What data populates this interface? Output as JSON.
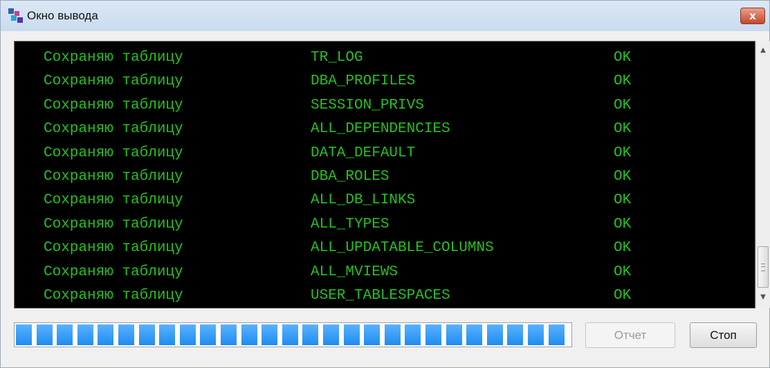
{
  "window": {
    "title": "Окно вывода",
    "close_label": "x"
  },
  "console": {
    "lines": [
      {
        "action": "Сохраняю таблицу",
        "table": "TR_LOG",
        "status": "OK"
      },
      {
        "action": "Сохраняю таблицу",
        "table": "DBA_PROFILES",
        "status": "OK"
      },
      {
        "action": "Сохраняю таблицу",
        "table": "SESSION_PRIVS",
        "status": "OK"
      },
      {
        "action": "Сохраняю таблицу",
        "table": "ALL_DEPENDENCIES",
        "status": "OK"
      },
      {
        "action": "Сохраняю таблицу",
        "table": "DATA_DEFAULT",
        "status": "OK"
      },
      {
        "action": "Сохраняю таблицу",
        "table": "DBA_ROLES",
        "status": "OK"
      },
      {
        "action": "Сохраняю таблицу",
        "table": "ALL_DB_LINKS",
        "status": "OK"
      },
      {
        "action": "Сохраняю таблицу",
        "table": "ALL_TYPES",
        "status": "OK"
      },
      {
        "action": "Сохраняю таблицу",
        "table": "ALL_UPDATABLE_COLUMNS",
        "status": "OK"
      },
      {
        "action": "Сохраняю таблицу",
        "table": "ALL_MVIEWS",
        "status": "OK"
      },
      {
        "action": "Сохраняю таблицу",
        "table": "USER_TABLESPACES",
        "status": "OK"
      }
    ]
  },
  "progress": {
    "segments": 27
  },
  "buttons": {
    "report_label": "Отчет",
    "stop_label": "Стоп",
    "report_enabled": false
  },
  "colors": {
    "console_text": "#23c21e",
    "console_bg": "#000000",
    "progress_fill": "#1e8cf0"
  },
  "icons": {
    "app": "app-windows-icon",
    "close": "close-icon",
    "scroll_up": "arrow-up-icon",
    "scroll_down": "arrow-down-icon"
  }
}
